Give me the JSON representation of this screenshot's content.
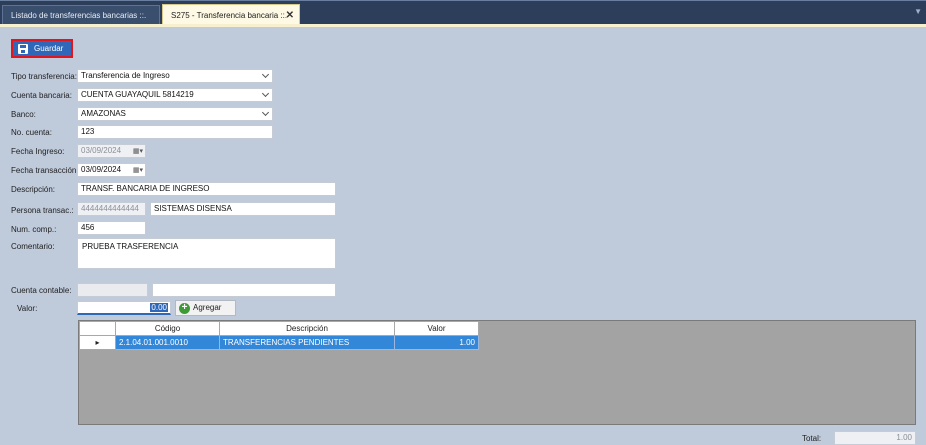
{
  "tabs": [
    {
      "label": "Listado de transferencias bancarias ::.",
      "active": false
    },
    {
      "label": "S275 - Transferencia bancaria ::.",
      "active": true
    }
  ],
  "toolbar": {
    "save_label": "Guardar"
  },
  "form": {
    "tipo_transferencia": {
      "label": "Tipo transferencia:",
      "value": "Transferencia de Ingreso"
    },
    "cuenta_bancaria": {
      "label": "Cuenta bancaria:",
      "value": "CUENTA GUAYAQUIL 5814219"
    },
    "banco": {
      "label": "Banco:",
      "value": "AMAZONAS"
    },
    "no_cuenta": {
      "label": "No. cuenta:",
      "value": "123"
    },
    "fecha_ingreso": {
      "label": "Fecha Ingreso:",
      "value": "03/09/2024"
    },
    "fecha_transaccion": {
      "label": "Fecha transacción:",
      "value": "03/09/2024"
    },
    "descripcion": {
      "label": "Descripción:",
      "value": "TRANSF. BANCARIA DE INGRESO"
    },
    "persona_transac": {
      "label": "Persona transac.:",
      "id": "4444444444444",
      "name": "SISTEMAS DISENSA"
    },
    "num_comp": {
      "label": "Num. comp.:",
      "value": "456"
    },
    "comentario": {
      "label": "Comentario:",
      "value": "PRUEBA TRASFERENCIA"
    },
    "cuenta_contable": {
      "label": "Cuenta contable:",
      "code": "",
      "name": ""
    },
    "valor": {
      "label": "Valor:",
      "value": "0.00"
    },
    "agregar_label": "Agregar"
  },
  "grid": {
    "columns": [
      "Código",
      "Descripción",
      "Valor"
    ],
    "rows": [
      {
        "codigo": "2.1.04.01.001.0010",
        "descripcion": "TRANSFERENCIAS PENDIENTES",
        "valor": "1.00"
      }
    ]
  },
  "total": {
    "label": "Total:",
    "value": "1.00"
  },
  "colors": {
    "accent": "#2f68b8",
    "selection": "#3387d8",
    "highlight_border": "#e3141c"
  }
}
